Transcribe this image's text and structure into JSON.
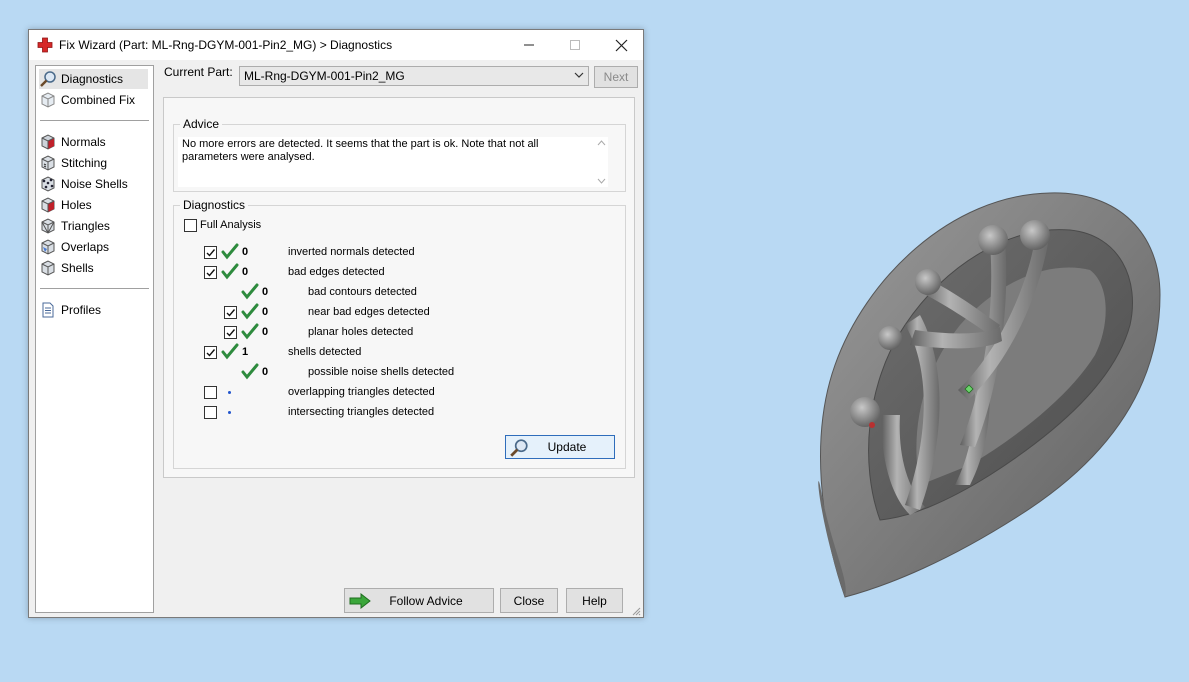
{
  "window": {
    "title": "Fix Wizard (Part: ML-Rng-DGYM-001-Pin2_MG) > Diagnostics",
    "controls": [
      "minimize",
      "maximize",
      "close"
    ]
  },
  "sidebar": {
    "items": [
      {
        "label": "Diagnostics",
        "icon": "magnifier-icon",
        "selected": true
      },
      {
        "label": "Combined Fix",
        "icon": "cube-icon"
      },
      {
        "label": "Normals",
        "icon": "normals-cube-icon"
      },
      {
        "label": "Stitching",
        "icon": "stitching-cube-icon"
      },
      {
        "label": "Noise Shells",
        "icon": "noise-shells-icon"
      },
      {
        "label": "Holes",
        "icon": "holes-cube-icon"
      },
      {
        "label": "Triangles",
        "icon": "triangles-cube-icon"
      },
      {
        "label": "Overlaps",
        "icon": "overlaps-cube-icon"
      },
      {
        "label": "Shells",
        "icon": "shells-cube-icon"
      },
      {
        "label": "Profiles",
        "icon": "document-icon"
      }
    ]
  },
  "toolbar": {
    "current_part_label": "Current Part:",
    "current_part_value": "ML-Rng-DGYM-001-Pin2_MG",
    "next_label": "Next"
  },
  "advice": {
    "title": "Advice",
    "text": "No more errors are detected. It seems that the part is ok. Note that not all parameters were analysed."
  },
  "diagnostics": {
    "title": "Diagnostics",
    "full_analysis_label": "Full Analysis",
    "rows": [
      {
        "checkbox": true,
        "checked": true,
        "status": "ok",
        "count": "0",
        "label": "inverted normals detected",
        "indent": 0
      },
      {
        "checkbox": true,
        "checked": true,
        "status": "ok",
        "count": "0",
        "label": "bad edges detected",
        "indent": 0
      },
      {
        "checkbox": false,
        "checked": false,
        "status": "ok",
        "count": "0",
        "label": "bad contours detected",
        "indent": 1
      },
      {
        "checkbox": true,
        "checked": true,
        "status": "ok",
        "count": "0",
        "label": "near bad edges detected",
        "indent": 1
      },
      {
        "checkbox": true,
        "checked": true,
        "status": "ok",
        "count": "0",
        "label": "planar holes detected",
        "indent": 1
      },
      {
        "checkbox": true,
        "checked": true,
        "status": "ok",
        "count": "1",
        "label": "shells detected",
        "indent": 0
      },
      {
        "checkbox": false,
        "checked": false,
        "status": "ok",
        "count": "0",
        "label": "possible noise shells detected",
        "indent": 1
      },
      {
        "checkbox": true,
        "checked": false,
        "status": "not-analysed",
        "count": "",
        "label": "overlapping triangles detected",
        "indent": 0
      },
      {
        "checkbox": true,
        "checked": false,
        "status": "not-analysed",
        "count": "",
        "label": "intersecting triangles detected",
        "indent": 0
      }
    ],
    "update_label": "Update"
  },
  "footer": {
    "follow_advice_label": "Follow Advice",
    "close_label": "Close",
    "help_label": "Help"
  },
  "colors": {
    "desktop": "#b9d9f3",
    "check_green": "#2e8b3e",
    "app_cross_red": "#d62828",
    "model_gray": "#8a8a8a"
  }
}
